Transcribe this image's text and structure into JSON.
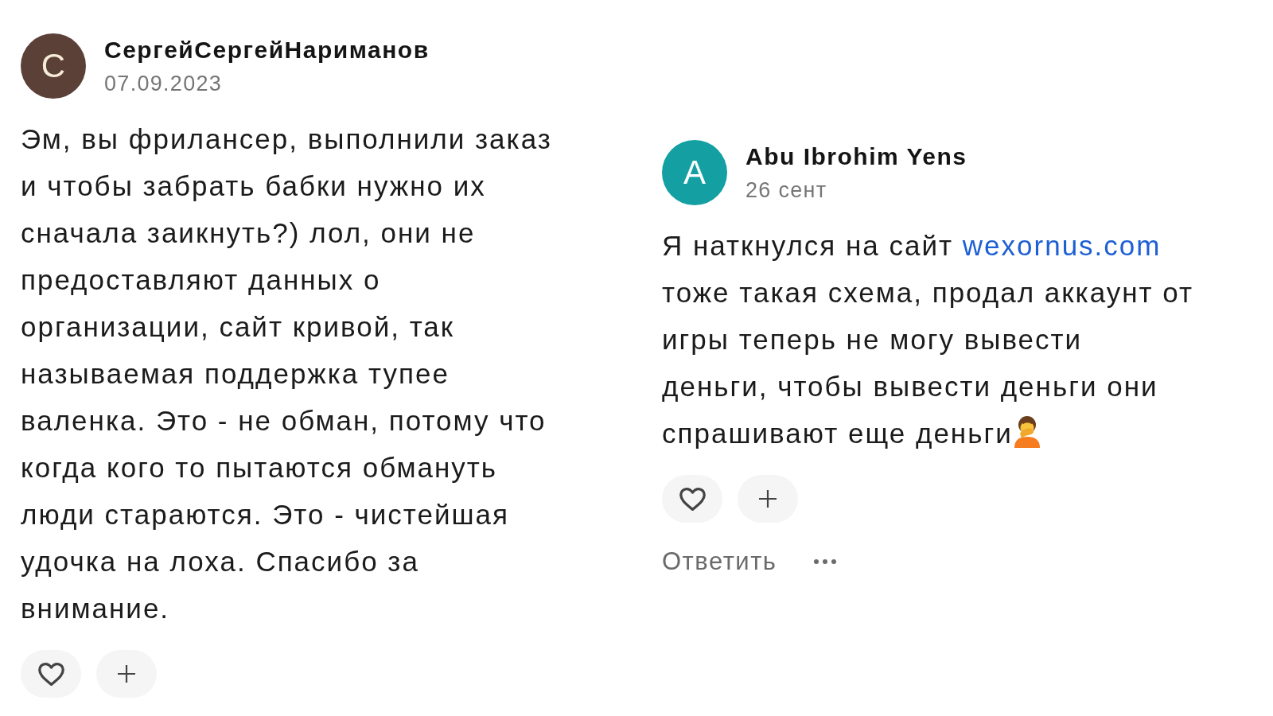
{
  "comments": [
    {
      "avatar": {
        "letter": "С",
        "color": "#5b4037"
      },
      "author": "СергейСергейНариманов",
      "date": "07.09.2023",
      "body": [
        {
          "kind": "text",
          "text": "Эм, вы фрилансер, выполнили заказ и чтобы забрать бабки нужно их сначала заикнуть?) лол, они не предоставляют данных о организации, сайт кривой, так называемая поддержка тупее валенка. Это - не обман, потому что когда кого то пытаются обмануть люди стараются. Это - чистейшая удочка на лоха. Спасибо за внимание."
        }
      ],
      "liked": false
    },
    {
      "avatar": {
        "letter": "A",
        "color": "#14a0a3"
      },
      "author": "Abu Ibrohim Yens",
      "date": "26 сент",
      "body": [
        {
          "kind": "text",
          "text": "Я наткнулся на сайт "
        },
        {
          "kind": "link",
          "text": "wexornus.com"
        },
        {
          "kind": "text",
          "text": " тоже такая схема, продал аккаунт от игры теперь не могу вывести деньги, чтобы вывести деньги они спрашивают еще деньги"
        },
        {
          "kind": "facepalm"
        }
      ],
      "liked": false,
      "reply": "Ответить"
    }
  ]
}
